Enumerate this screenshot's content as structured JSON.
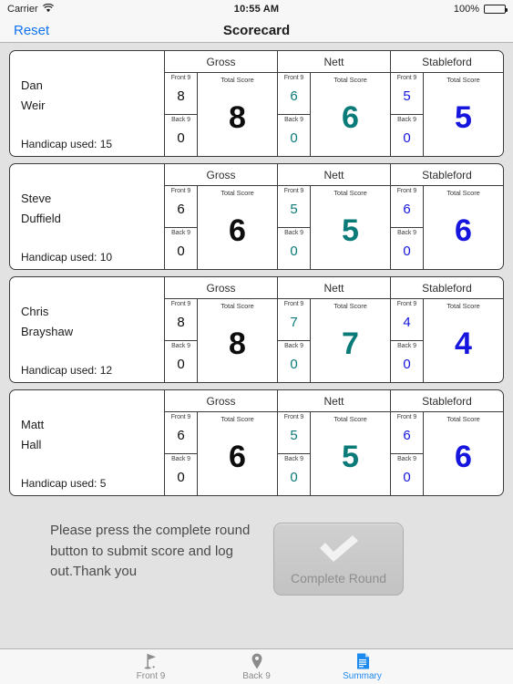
{
  "status_bar": {
    "carrier": "Carrier",
    "wifi_icon": "wifi-icon",
    "time": "10:55 AM",
    "battery_percent": "100%",
    "battery_icon": "battery-icon"
  },
  "nav_bar": {
    "reset_label": "Reset",
    "title": "Scorecard"
  },
  "colors": {
    "gross": "#0d0d0d",
    "nett": "#0a7b78",
    "stableford": "#1515dd",
    "accent": "#1d8af0"
  },
  "column_headers": {
    "gross": "Gross",
    "nett": "Nett",
    "stableford": "Stableford",
    "front9": "Front 9",
    "back9": "Back 9",
    "total": "Total Score"
  },
  "handicap_prefix": "Handicap used: ",
  "players": [
    {
      "first_name": "Dan",
      "last_name": "Weir",
      "handicap_label": "Handicap used: 15",
      "handicap": 15,
      "gross": {
        "front9": "8",
        "back9": "0",
        "total": "8"
      },
      "nett": {
        "front9": "6",
        "back9": "0",
        "total": "6"
      },
      "stableford": {
        "front9": "5",
        "back9": "0",
        "total": "5"
      }
    },
    {
      "first_name": "Steve",
      "last_name": "Duffield",
      "handicap_label": "Handicap used: 10",
      "handicap": 10,
      "gross": {
        "front9": "6",
        "back9": "0",
        "total": "6"
      },
      "nett": {
        "front9": "5",
        "back9": "0",
        "total": "5"
      },
      "stableford": {
        "front9": "6",
        "back9": "0",
        "total": "6"
      }
    },
    {
      "first_name": "Chris",
      "last_name": "Brayshaw",
      "handicap_label": "Handicap used: 12",
      "handicap": 12,
      "gross": {
        "front9": "8",
        "back9": "0",
        "total": "8"
      },
      "nett": {
        "front9": "7",
        "back9": "0",
        "total": "7"
      },
      "stableford": {
        "front9": "4",
        "back9": "0",
        "total": "4"
      }
    },
    {
      "first_name": "Matt",
      "last_name": "Hall",
      "handicap_label": "Handicap used: 5",
      "handicap": 5,
      "gross": {
        "front9": "6",
        "back9": "0",
        "total": "6"
      },
      "nett": {
        "front9": "5",
        "back9": "0",
        "total": "5"
      },
      "stableford": {
        "front9": "6",
        "back9": "0",
        "total": "6"
      }
    }
  ],
  "footer": {
    "instructions": "Please press the complete round button to submit score and log out.Thank you",
    "complete_button_label": "Complete Round",
    "complete_button_icon": "checkmark-icon"
  },
  "tab_bar": {
    "items": [
      {
        "label": "Front 9",
        "icon": "flag-icon",
        "active": false
      },
      {
        "label": "Back 9",
        "icon": "map-pin-icon",
        "active": false
      },
      {
        "label": "Summary",
        "icon": "document-icon",
        "active": true
      }
    ]
  }
}
